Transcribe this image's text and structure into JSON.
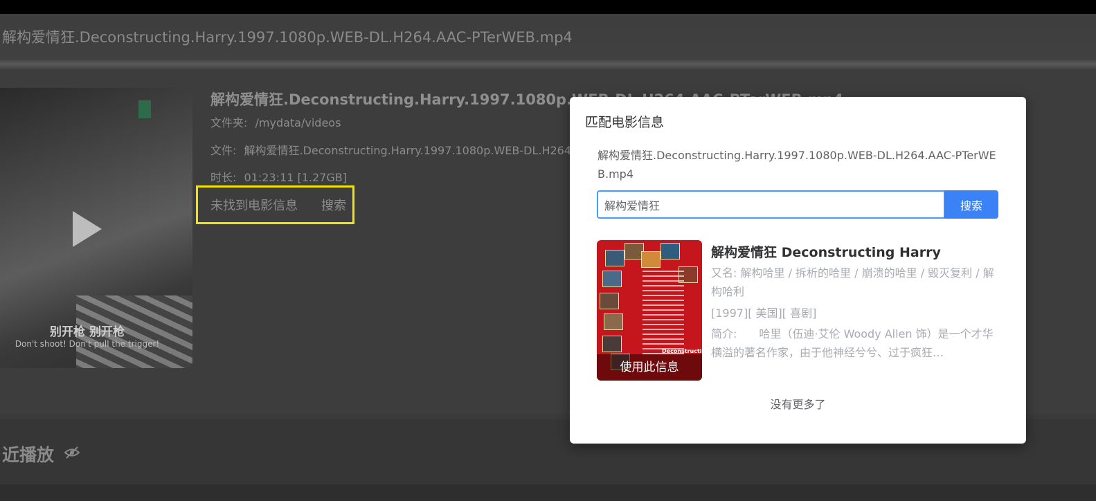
{
  "header": {
    "title": "解构爱情狂.Deconstructing.Harry.1997.1080p.WEB-DL.H264.AAC-PTerWEB.mp4"
  },
  "video": {
    "subtitle_cn": "别开枪 别开枪",
    "subtitle_en": "Don't shoot! Don't pull the trigger!",
    "title": "解构爱情狂.Deconstructing.Harry.1997.1080p.WEB-DL.H264.AAC-PTerWEB.mp4",
    "folder_label": "文件夹:",
    "folder_value": "/mydata/videos",
    "file_label": "文件:",
    "file_value": "解构爱情狂.Deconstructing.Harry.1997.1080p.WEB-DL.H264.AAC-PTerWEB.mp4",
    "duration_label": "时长:",
    "duration_value": "01:23:11 [1.27GB]",
    "not_found_text": "未找到电影信息",
    "search_link": "搜索"
  },
  "recent": {
    "title": "近播放"
  },
  "dialog": {
    "title": "匹配电影信息",
    "filename": "解构爱情狂.Deconstructing.Harry.1997.1080p.WEB-DL.H264.AAC-PTerWEB.mp4",
    "search_value": "解构爱情狂",
    "search_button": "搜索",
    "results": [
      {
        "title": "解构爱情狂 Deconstructing Harry",
        "aliases": "又名: 解构哈里 / 拆析的哈里 / 崩溃的哈里 / 毁灭复利 / 解构哈利",
        "meta": "[1997][ 美国][ 喜剧]",
        "summary": "简介:　　哈里（伍迪·艾伦 Woody Allen 饰）是一个才华横溢的著名作家，由于他神经兮兮、过于疯狂…",
        "poster_word": "Deconstructing",
        "use_button": "使用此信息"
      }
    ],
    "no_more": "没有更多了"
  },
  "colors": {
    "highlight": "#f4e40c",
    "primary": "#3b82f6",
    "poster_red": "#c4161c"
  }
}
